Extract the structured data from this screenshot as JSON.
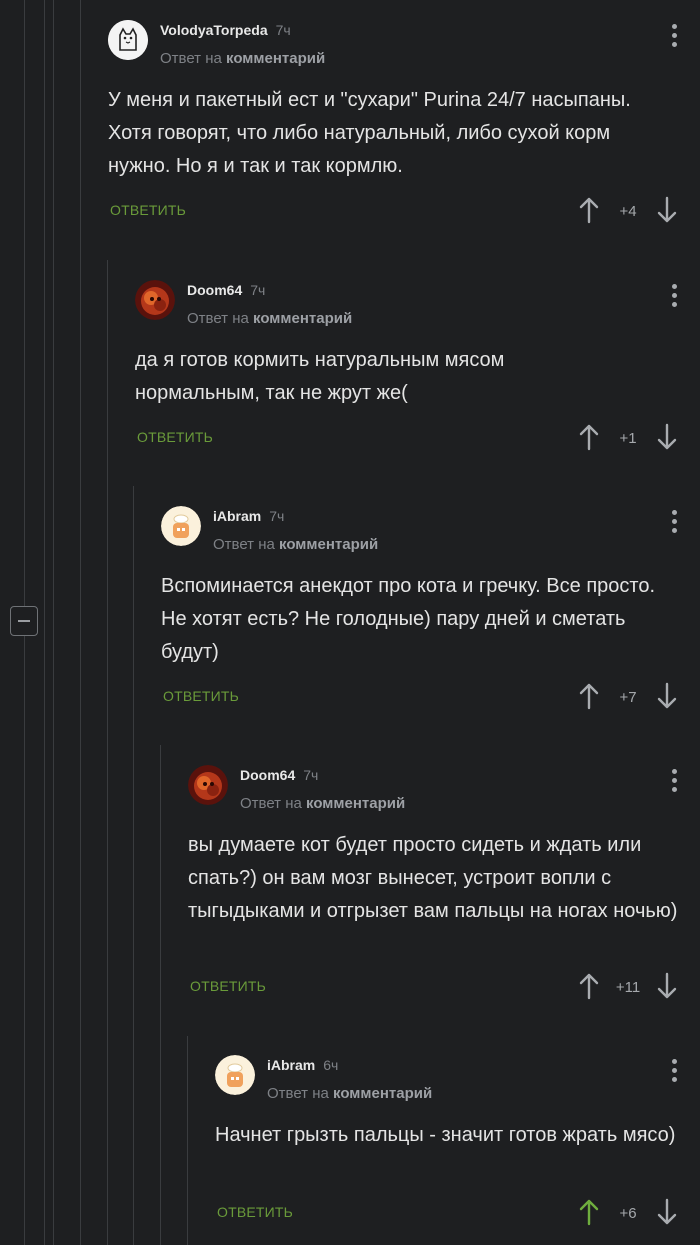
{
  "comments": [
    {
      "author": "VolodyaTorpeda",
      "time": "7ч",
      "reply_prefix": "Ответ на",
      "reply_target": "комментарий",
      "text": "У меня и пакетный ест и \"сухари\" Purina 24/7 насыпаны. Хотя говорят, что либо натуральный, либо сухой корм нужно. Но я и так и так кормлю.",
      "reply_label": "ОТВЕТИТЬ",
      "score": "+4",
      "avatar": "cat-icon"
    },
    {
      "author": "Doom64",
      "time": "7ч",
      "reply_prefix": "Ответ на",
      "reply_target": "комментарий",
      "text": "да я готов кормить натуральным мясом нормальным, так не жрут же(",
      "reply_label": "ОТВЕТИТЬ",
      "score": "+1",
      "avatar": "fire-demon-icon"
    },
    {
      "author": "iAbram",
      "time": "7ч",
      "reply_prefix": "Ответ на",
      "reply_target": "комментарий",
      "text": "Вспоминается анекдот про кота и гречку. Все просто. Не хотят есть? Не голодные) пару дней и сметать будут)",
      "reply_label": "ОТВЕТИТЬ",
      "score": "+7",
      "avatar": "chef-icon"
    },
    {
      "author": "Doom64",
      "time": "7ч",
      "reply_prefix": "Ответ на",
      "reply_target": "комментарий",
      "text": "вы думаете кот будет просто сидеть и ждать или спать?) он вам мозг вынесет, устроит вопли с тыгыдыками и отгрызет вам пальцы на ногах ночью)",
      "reply_label": "ОТВЕТИТЬ",
      "score": "+11",
      "avatar": "fire-demon-icon"
    },
    {
      "author": "iAbram",
      "time": "6ч",
      "reply_prefix": "Ответ на",
      "reply_target": "комментарий",
      "text": "Начнет грызть пальцы - значит готов жрать мясо)",
      "reply_label": "ОТВЕТИТЬ",
      "score": "+6",
      "avatar": "chef-icon",
      "upvoted": true
    }
  ],
  "colors": {
    "background": "#1e1f21",
    "reply_green": "#6a9b3a",
    "upvote_active": "#6fae3e",
    "muted": "#7e8186"
  }
}
